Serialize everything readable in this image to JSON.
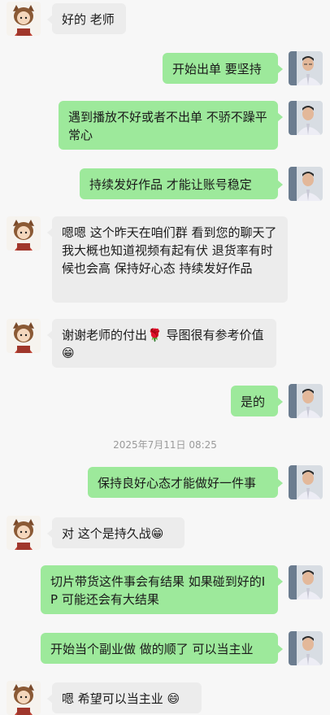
{
  "messages": [
    {
      "side": "left",
      "text": "好的 老师"
    },
    {
      "side": "right",
      "text": "开始出单 要坚持"
    },
    {
      "side": "right",
      "text": "遇到播放不好或者不出单 不骄不躁平常心"
    },
    {
      "side": "right",
      "text": "持续发好作品  才能让账号稳定"
    },
    {
      "side": "left",
      "text": "嗯嗯 这个昨天在咱们群 看到您的聊天了 我大概也知道视频有起有伏 退货率有时候也会高 保持好心态 持续发好作品"
    },
    {
      "side": "left",
      "text": "谢谢老师的付出🌹 导图很有参考价值😁"
    },
    {
      "side": "right",
      "text": "是的"
    },
    {
      "side": "right",
      "text": "保持良好心态才能做好一件事"
    },
    {
      "side": "left",
      "text": "对 这个是持久战😁"
    },
    {
      "side": "right",
      "text": "切片带货这件事会有结果  如果碰到好的IP 可能还会有大结果"
    },
    {
      "side": "right",
      "text": "开始当个副业做 做的顺了 可以当主业"
    },
    {
      "side": "left",
      "text": "嗯 希望可以当主业 😄"
    }
  ],
  "timestamp": "2025年7月11日 08:25",
  "colors": {
    "background": "#f7f7f7",
    "bubble_self": "#9de99b",
    "bubble_other": "#ececec",
    "timestamp_text": "#9a9a9a"
  },
  "avatars": {
    "left": "girl-cartoon-avatar",
    "right": "man-photo-avatar"
  }
}
